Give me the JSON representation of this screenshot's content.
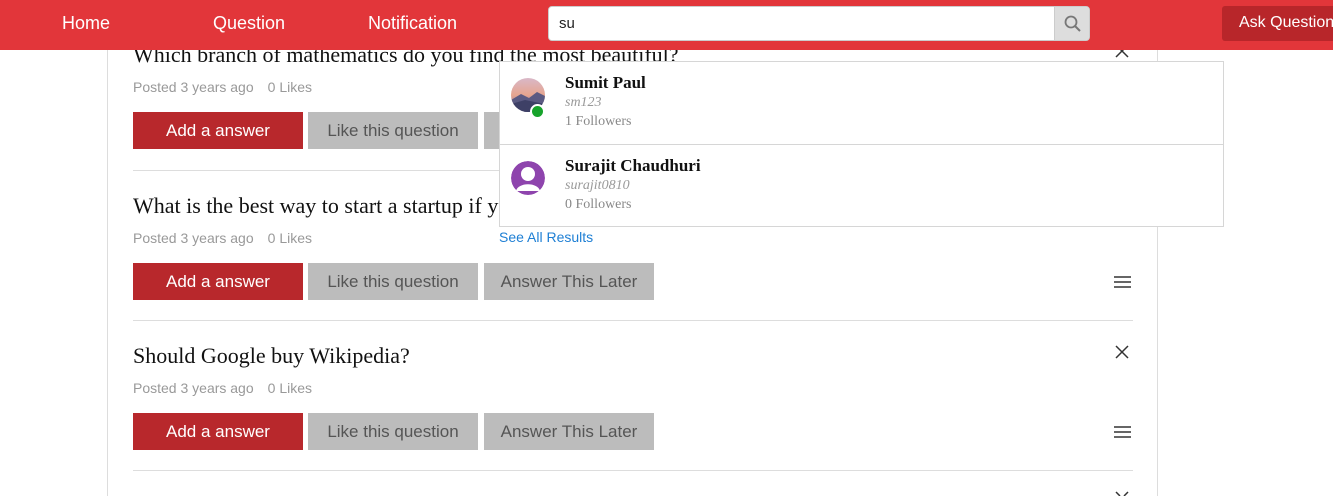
{
  "nav": {
    "home": "Home",
    "question": "Question",
    "notification": "Notification",
    "ask_button": "Ask Question",
    "search_value": "su",
    "search_icon": "magnifier-icon"
  },
  "questions": [
    {
      "title": "Which branch of mathematics do you find the most beautiful?",
      "posted": "Posted 3 years ago",
      "likes": "0 Likes"
    },
    {
      "title": "What is the best way to start a startup if you have no money?",
      "posted": "Posted 3 years ago",
      "likes": "0 Likes"
    },
    {
      "title": "Should Google buy Wikipedia?",
      "posted": "Posted 3 years ago",
      "likes": "0 Likes"
    }
  ],
  "buttons": {
    "answer": "Add a answer",
    "like": "Like this question",
    "later": "Answer This Later"
  },
  "search_results": [
    {
      "name": "Sumit Paul",
      "username": "sm123",
      "followers": "1 Followers",
      "online": true
    },
    {
      "name": "Surajit Chaudhuri",
      "username": "surajit0810",
      "followers": "0 Followers",
      "online": false
    }
  ],
  "see_all": "See All Results",
  "colors": {
    "navbar": "#e2363a",
    "primary_button": "#b8282c",
    "secondary_button": "#bcbcbc",
    "link": "#1e7fd4",
    "online": "#17a32b"
  }
}
